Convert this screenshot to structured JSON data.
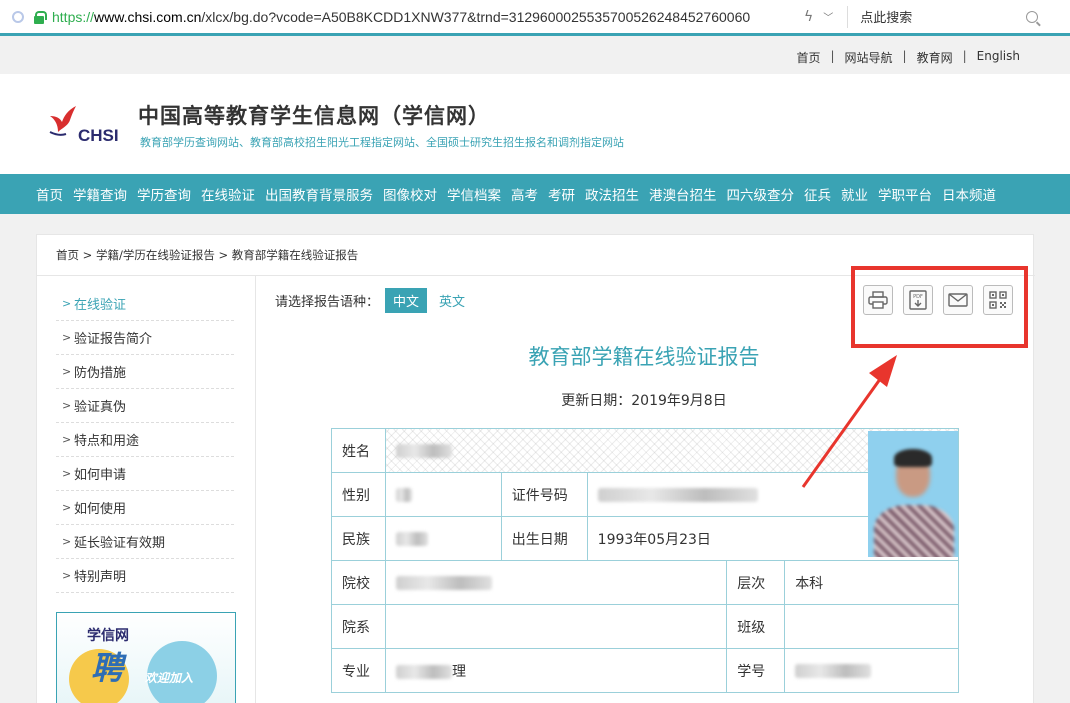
{
  "browser": {
    "url_scheme": "https://",
    "url_host": "www.chsi.com.cn",
    "url_path": "/xlcx/bg.do?vcode=A50B8KCDD1XNW377&trnd=3129600025535700526248452760060",
    "search_placeholder": "点此搜索"
  },
  "toplinks": [
    "首页",
    "网站导航",
    "教育网",
    "English"
  ],
  "header": {
    "logo_text": "CHSI",
    "title": "中国高等教育学生信息网（学信网）",
    "subtitle": "教育部学历查询网站、教育部高校招生阳光工程指定网站、全国硕士研究生招生报名和调剂指定网站"
  },
  "nav": [
    "首页",
    "学籍查询",
    "学历查询",
    "在线验证",
    "出国教育背景服务",
    "图像校对",
    "学信档案",
    "高考",
    "考研",
    "政法招生",
    "港澳台招生",
    "四六级查分",
    "征兵",
    "就业",
    "学职平台",
    "日本频道"
  ],
  "breadcrumb": {
    "home": "首页",
    "sep": ">",
    "level1": "学籍/学历在线验证报告",
    "level2": "教育部学籍在线验证报告"
  },
  "sidebar": [
    {
      "label": "在线验证",
      "active": true
    },
    {
      "label": "验证报告简介",
      "active": false
    },
    {
      "label": "防伪措施",
      "active": false
    },
    {
      "label": "验证真伪",
      "active": false
    },
    {
      "label": "特点和用途",
      "active": false
    },
    {
      "label": "如何申请",
      "active": false
    },
    {
      "label": "如何使用",
      "active": false
    },
    {
      "label": "延长验证有效期",
      "active": false
    },
    {
      "label": "特别声明",
      "active": false
    }
  ],
  "banner": {
    "brand": "学信网",
    "big": "聘",
    "small": "欢迎加入"
  },
  "lang": {
    "label": "请选择报告语种：",
    "selected": "中文",
    "other": "英文"
  },
  "tools": [
    "print-icon",
    "pdf-download-icon",
    "mail-icon",
    "qrcode-icon"
  ],
  "report": {
    "title": "教育部学籍在线验证报告",
    "date": "更新日期：2019年9月8日",
    "labels": {
      "name": "姓名",
      "gender": "性别",
      "id_number": "证件号码",
      "ethnicity": "民族",
      "birthdate": "出生日期",
      "school": "院校",
      "level": "层次",
      "department": "院系",
      "class": "班级",
      "major": "专业",
      "student_id": "学号"
    },
    "values": {
      "birthdate": "1993年05月23日",
      "level": "本科",
      "major_suffix": "理"
    }
  },
  "colors": {
    "brand": "#3aa3b4",
    "annotation": "#e8352d"
  }
}
